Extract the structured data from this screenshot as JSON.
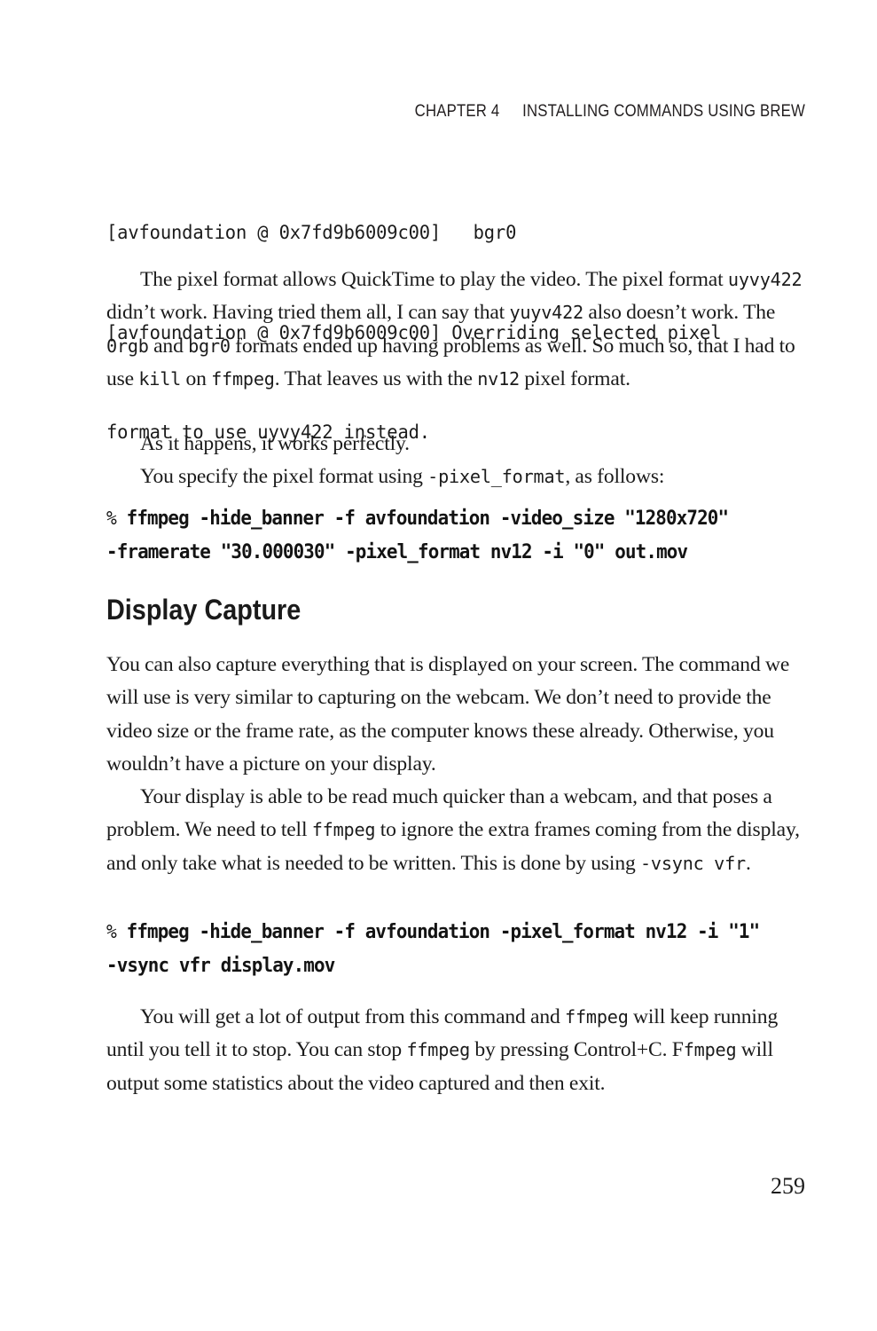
{
  "page": {
    "running_head": {
      "chapter": "CHAPTER 4",
      "title": "INSTALLING COMMANDS USING BREW"
    },
    "folio": "259"
  },
  "content": {
    "console_output": {
      "line1": "[avfoundation @ 0x7fd9b6009c00]   bgr0",
      "line2": "[avfoundation @ 0x7fd9b6009c00] Overriding selected pixel",
      "line3": "format to use uyvy422 instead."
    },
    "paragraph_1": {
      "seg1": "The pixel format allows QuickTime to play the video. The pixel format ",
      "code1": "uyvy422",
      "seg2": " didn’t work. Having tried them all, I can say that ",
      "code2": "yuyv422",
      "seg3": " also doesn’t work. The ",
      "code3": "0rgb",
      "seg4": " and ",
      "code4": "bgr0",
      "seg5": " formats ended up having problems as well. So much so, that I had to use ",
      "code5": "kill",
      "seg6": " on ",
      "code6": "ffmpeg",
      "seg7": ". That leaves us with the ",
      "code7": "nv12",
      "seg8": " pixel format."
    },
    "paragraph_2": "As it happens, it works perfectly.",
    "paragraph_3": {
      "seg1": "You specify the pixel format using ",
      "code1": "-pixel_format",
      "seg2": ", as follows:"
    },
    "command_1": {
      "prompt": "%",
      "line1": " ffmpeg -hide_banner -f avfoundation -video_size \"1280x720\"",
      "line2": "-framerate \"30.000030\" -pixel_format nv12 -i \"0\" out.mov"
    },
    "heading_1": "Display Capture",
    "paragraph_4": "You can also capture everything that is displayed on your screen. The command we will use is very similar to capturing on the webcam. We don’t need to provide the video size or the frame rate, as the computer knows these already. Otherwise, you wouldn’t have a picture on your display.",
    "paragraph_5": {
      "seg1": "Your display is able to be read much quicker than a webcam, and that poses a problem. We need to tell ",
      "code1": "ffmpeg",
      "seg2": " to ignore the extra frames coming from the display, and only take what is needed to be written. This is done by using ",
      "code2": "-vsync vfr",
      "seg3": "."
    },
    "command_2": {
      "prompt": "%",
      "line1": " ffmpeg -hide_banner -f avfoundation -pixel_format nv12 -i \"1\"",
      "line2": "-vsync vfr display.mov"
    },
    "paragraph_6": {
      "seg1": "You will get a lot of output from this command and ",
      "code1": "ffmpeg",
      "seg2": " will keep running until you tell it to stop. You can stop ",
      "code2": "ffmpeg",
      "seg3": " by pressing Control+C. F",
      "code3": "fmpeg",
      "seg4": " will output some statistics about the video captured and then exit."
    }
  }
}
